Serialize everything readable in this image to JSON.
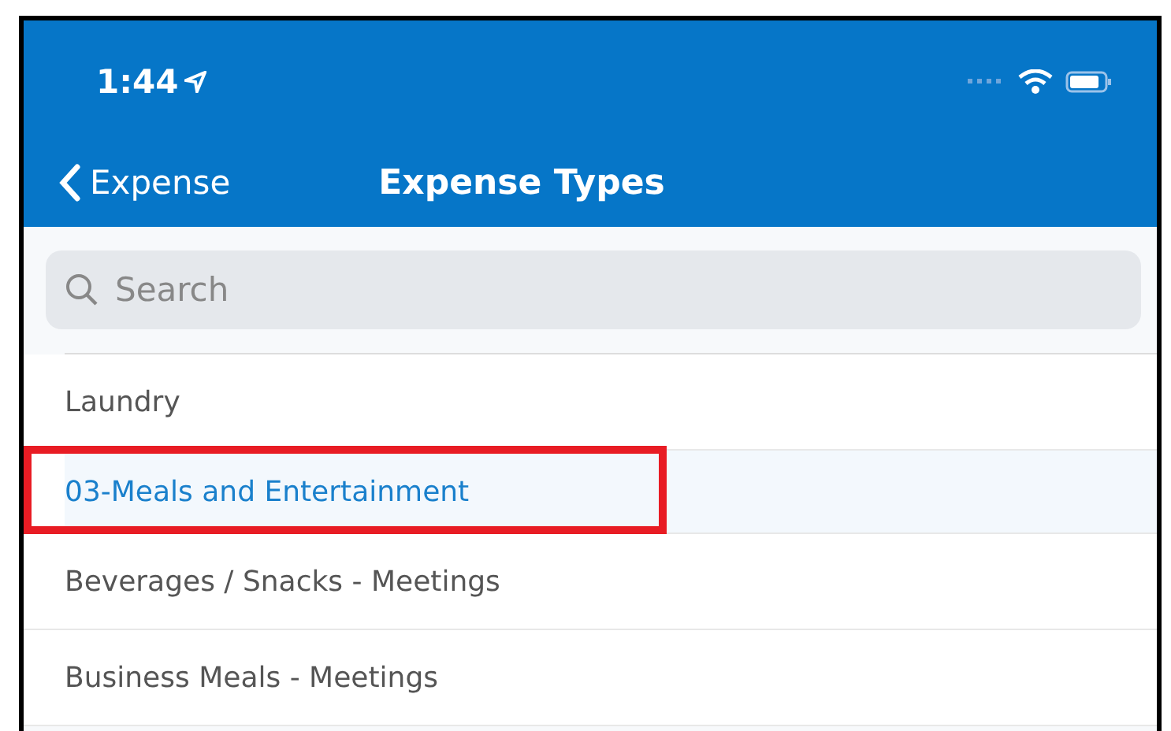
{
  "status_bar": {
    "time": "1:44"
  },
  "nav": {
    "back": "Expense",
    "title": "Expense Types"
  },
  "search": {
    "placeholder": "Search"
  },
  "items": [
    {
      "label": "Laundry",
      "selected": false,
      "annotated": false
    },
    {
      "label": "03-Meals and Entertainment",
      "selected": true,
      "annotated": true
    },
    {
      "label": "Beverages / Snacks - Meetings",
      "selected": false,
      "annotated": false
    },
    {
      "label": "Business Meals - Meetings",
      "selected": false,
      "annotated": false
    }
  ]
}
